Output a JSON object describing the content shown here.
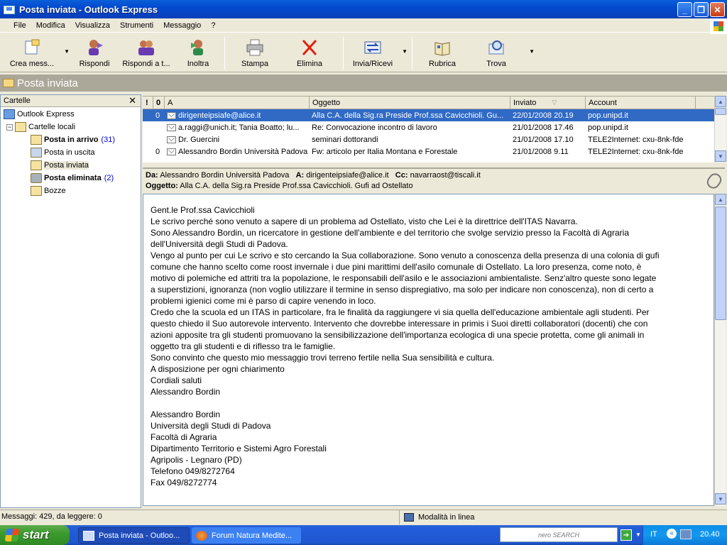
{
  "window": {
    "title": "Posta inviata - Outlook Express"
  },
  "menu": [
    "File",
    "Modifica",
    "Visualizza",
    "Strumenti",
    "Messaggio",
    "?"
  ],
  "toolbar": {
    "crea": "Crea mess...",
    "rispondi": "Rispondi",
    "rispondi_tutti": "Rispondi a t...",
    "inoltra": "Inoltra",
    "stampa": "Stampa",
    "elimina": "Elimina",
    "invia_ricevi": "Invia/Ricevi",
    "rubrica": "Rubrica",
    "trova": "Trova"
  },
  "folder_title": "Posta inviata",
  "folders_pane": {
    "header": "Cartelle",
    "close": "✕",
    "items": [
      {
        "label": "Outlook Express",
        "bold": false,
        "count": ""
      },
      {
        "label": "Cartelle locali",
        "bold": false,
        "count": ""
      },
      {
        "label": "Posta in arrivo",
        "bold": true,
        "count": "(31)"
      },
      {
        "label": "Posta in uscita",
        "bold": false,
        "count": ""
      },
      {
        "label": "Posta inviata",
        "bold": false,
        "count": ""
      },
      {
        "label": "Posta eliminata",
        "bold": true,
        "count": "(2)"
      },
      {
        "label": "Bozze",
        "bold": false,
        "count": ""
      }
    ]
  },
  "message_list": {
    "columns": {
      "priority": "!",
      "attach": "0",
      "to": "A",
      "subject": "Oggetto",
      "sent": "Inviato",
      "account": "Account"
    },
    "rows": [
      {
        "attach": "0",
        "to": "dirigenteipsiafe@alice.it",
        "subject": "Alla C.A. della Sig.ra Preside  Prof.ssa Cavicchioli. Gu...",
        "sent": "22/01/2008 20.19",
        "account": "pop.unipd.it"
      },
      {
        "attach": "",
        "to": "a.raggi@unich.it; Tania Boatto; lu...",
        "subject": "Re: Convocazione incontro di lavoro",
        "sent": "21/01/2008 17.46",
        "account": "pop.unipd.it"
      },
      {
        "attach": "",
        "to": "Dr. Guercini",
        "subject": "seminari dottorandi",
        "sent": "21/01/2008 17.10",
        "account": "TELE2Internet: cxu-8nk-fde"
      },
      {
        "attach": "0",
        "to": "Alessandro Bordin Università Padova",
        "subject": "Fw: articolo per Italia Montana e Forestale",
        "sent": "21/01/2008 9.11",
        "account": "TELE2Internet: cxu-8nk-fde"
      }
    ]
  },
  "preview": {
    "from_label": "Da:",
    "from": "Alessandro Bordin Università Padova",
    "to_label": "A:",
    "to": "dirigenteipsiafe@alice.it",
    "cc_label": "Cc:",
    "cc": "navarraost@tiscali.it",
    "subject_label": "Oggetto:",
    "subject": "Alla C.A. della Sig.ra Preside  Prof.ssa Cavicchioli. Gufi ad Ostellato",
    "body": "Gent.le Prof.ssa Cavicchioli\nLe scrivo perché sono venuto a sapere di un problema ad Ostellato, visto che Lei è la direttrice dell'ITAS Navarra.\nSono Alessandro Bordin, un ricercatore in gestione dell'ambiente e del territorio che svolge servizio presso la Facoltà di Agraria\ndell'Università degli Studi di Padova.\nVengo al punto per cui Le scrivo e sto cercando la Sua collaborazione. Sono venuto a conoscenza della presenza di una colonia di gufi\ncomune che hanno scelto come roost invernale i due pini marittimi dell'asilo comunale di Ostellato. La loro presenza, come noto, è\nmotivo di polemiche ed attriti tra la popolazione, le responsabili dell'asilo e le associazioni ambientaliste. Senz'altro queste sono legate\na superstizioni, ignoranza (non voglio utilizzare il termine in senso dispregiativo, ma solo per indicare non conoscenza), non di certo a\nproblemi igienici come mi è parso di capire venendo in loco.\nCredo che la scuola ed un ITAS in particolare, fra le finalità da raggiungere vi sia quella dell'educazione ambientale agli studenti. Per\nquesto chiedo il Suo autorevole intervento. Intervento che dovrebbe interessare in primis i Suoi diretti collaboratori (docenti) che con\nazioni apposite tra gli studenti promuovano la sensibilizzazione dell'importanza ecologica di una specie protetta, come gli animali in\noggetto tra gli studenti e di riflesso tra le famiglie.\nSono convinto che questo mio messaggio trovi terreno fertile nella Sua sensibilità e cultura.\nA disposizione per ogni chiarimento\nCordiali saluti\nAlessandro Bordin\n\nAlessandro Bordin\nUniversità degli Studi di Padova\nFacoltà di Agraria\nDipartimento Territorio e Sistemi Agro Forestali\nAgripolis - Legnaro (PD)\nTelefono 049/8272764\nFax 049/8272774"
  },
  "statusbar": {
    "messages": "Messaggi: 429, da leggere: 0",
    "mode": "Modalità in linea"
  },
  "taskbar": {
    "start": "start",
    "tasks": [
      "Posta inviata - Outloo...",
      "Forum Natura Medite..."
    ],
    "search_brand": "nero SEARCH",
    "lang": "IT",
    "clock": "20.40"
  },
  "colors": {
    "selection": "#316ac5",
    "titlebar": "#0349d0",
    "taskbar": "#245edb",
    "start": "#3c9b2d"
  }
}
